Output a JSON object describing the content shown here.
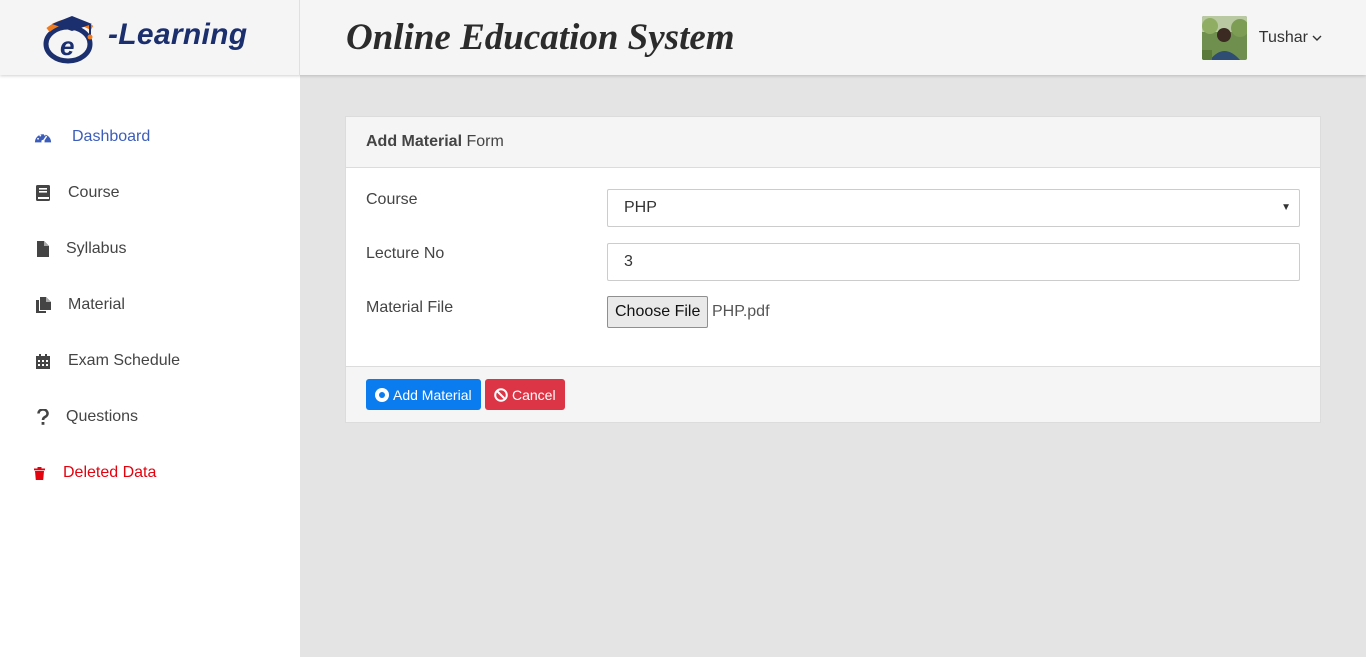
{
  "brand": {
    "logo_letter": "e",
    "text": "-Learning"
  },
  "header": {
    "title": "Online Education System"
  },
  "user": {
    "name": "Tushar",
    "avatar_icon": "user-photo-icon",
    "caret": "⌄"
  },
  "sidebar": {
    "items": [
      {
        "label": "Dashboard",
        "icon": "tachometer-icon",
        "active": true
      },
      {
        "label": "Course",
        "icon": "book-icon"
      },
      {
        "label": "Syllabus",
        "icon": "file-icon"
      },
      {
        "label": "Material",
        "icon": "files-icon"
      },
      {
        "label": "Exam Schedule",
        "icon": "calendar-icon"
      },
      {
        "label": "Questions",
        "icon": "question-icon"
      },
      {
        "label": "Deleted Data",
        "icon": "trash-icon",
        "danger": true
      }
    ]
  },
  "form": {
    "header_bold": "Add Material",
    "header_rest": "Form",
    "fields": {
      "course": {
        "label": "Course",
        "value": "PHP"
      },
      "lecture": {
        "label": "Lecture No",
        "value": "3"
      },
      "file": {
        "label": "Material File",
        "button": "Choose File",
        "filename": "PHP.pdf"
      }
    },
    "buttons": {
      "submit": "Add Material",
      "cancel": "Cancel"
    }
  },
  "colors": {
    "accent": "#3d5dba",
    "primary": "#0b7cf0",
    "danger": "#dc3545",
    "deleted": "#e3030f"
  }
}
